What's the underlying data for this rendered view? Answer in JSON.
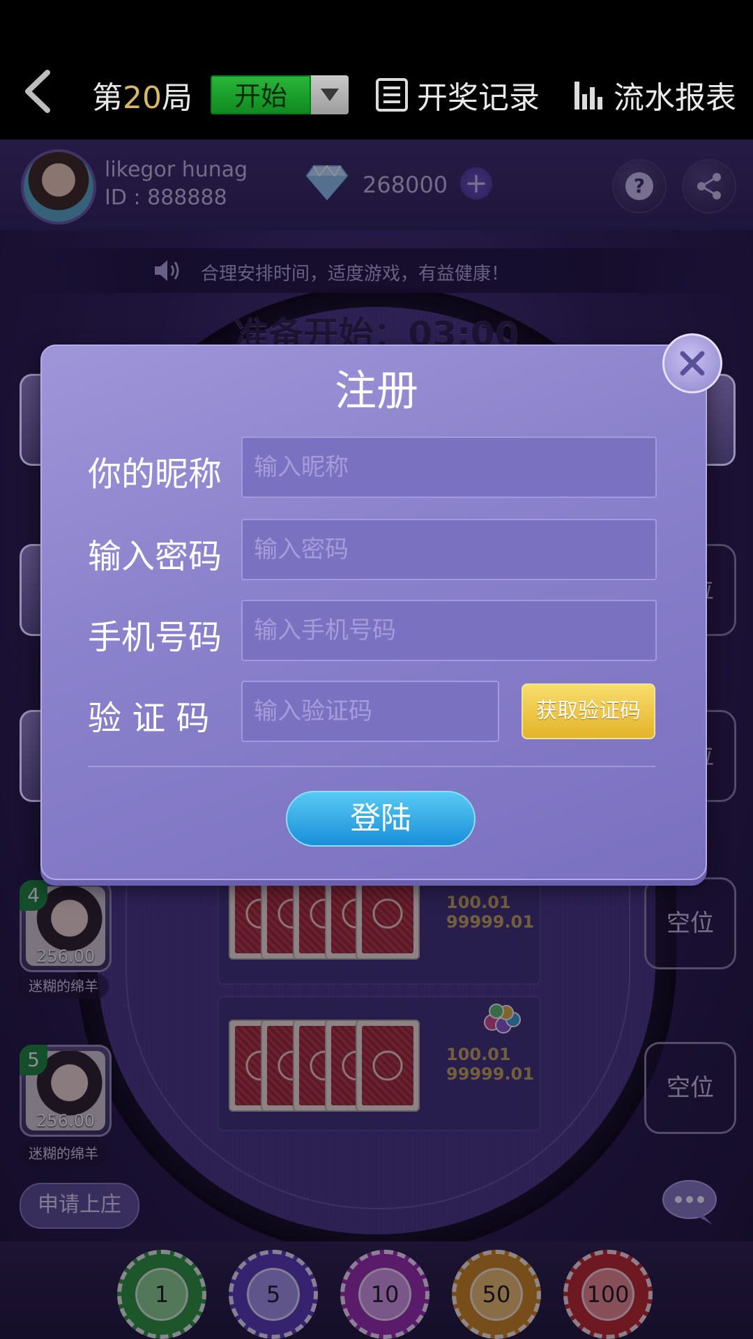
{
  "topbar": {
    "round_prefix": "第",
    "round_number": "20",
    "round_suffix": "局",
    "start_label": "开始",
    "history_label": "开奖记录",
    "report_label": "流水报表"
  },
  "profile": {
    "username": "likegor hunag",
    "user_id": "ID : 888888",
    "diamonds": "268000"
  },
  "notice": "合理安排时间，适度游戏，有益健康！",
  "countdown": "准备开始：03:00",
  "seats": [
    {
      "num": "4",
      "score": "256.00",
      "name": "迷糊的绵羊"
    },
    {
      "num": "5",
      "score": "256.00",
      "name": "迷糊的绵羊"
    }
  ],
  "empty_seat_label": "空位",
  "bet_boxes": [
    {
      "line1": "100.01",
      "line2": "99999.01"
    },
    {
      "line1": "100.01",
      "line2": "99999.01"
    }
  ],
  "apply_banker_label": "申请上庄",
  "chips": [
    {
      "value": "1",
      "color": "#2e9a3c"
    },
    {
      "value": "5",
      "color": "#5a3cb8"
    },
    {
      "value": "10",
      "color": "#9b2fb0"
    },
    {
      "value": "50",
      "color": "#d08a1c"
    },
    {
      "value": "100",
      "color": "#c02a2a"
    }
  ],
  "dialog": {
    "title": "注册",
    "nickname_label": "你的昵称",
    "nickname_placeholder": "输入昵称",
    "password_label": "输入密码",
    "password_placeholder": "输入密码",
    "phone_label": "手机号码",
    "phone_placeholder": "输入手机号码",
    "code_label": "验 证 码",
    "code_placeholder": "输入验证码",
    "get_code_label": "获取验证码",
    "login_label": "登陆"
  },
  "colors": {
    "accent_gold": "#d9b864",
    "start_green": "#1fa52f",
    "dialog_purple": "#8b82cc",
    "login_blue": "#2aa0e4"
  }
}
